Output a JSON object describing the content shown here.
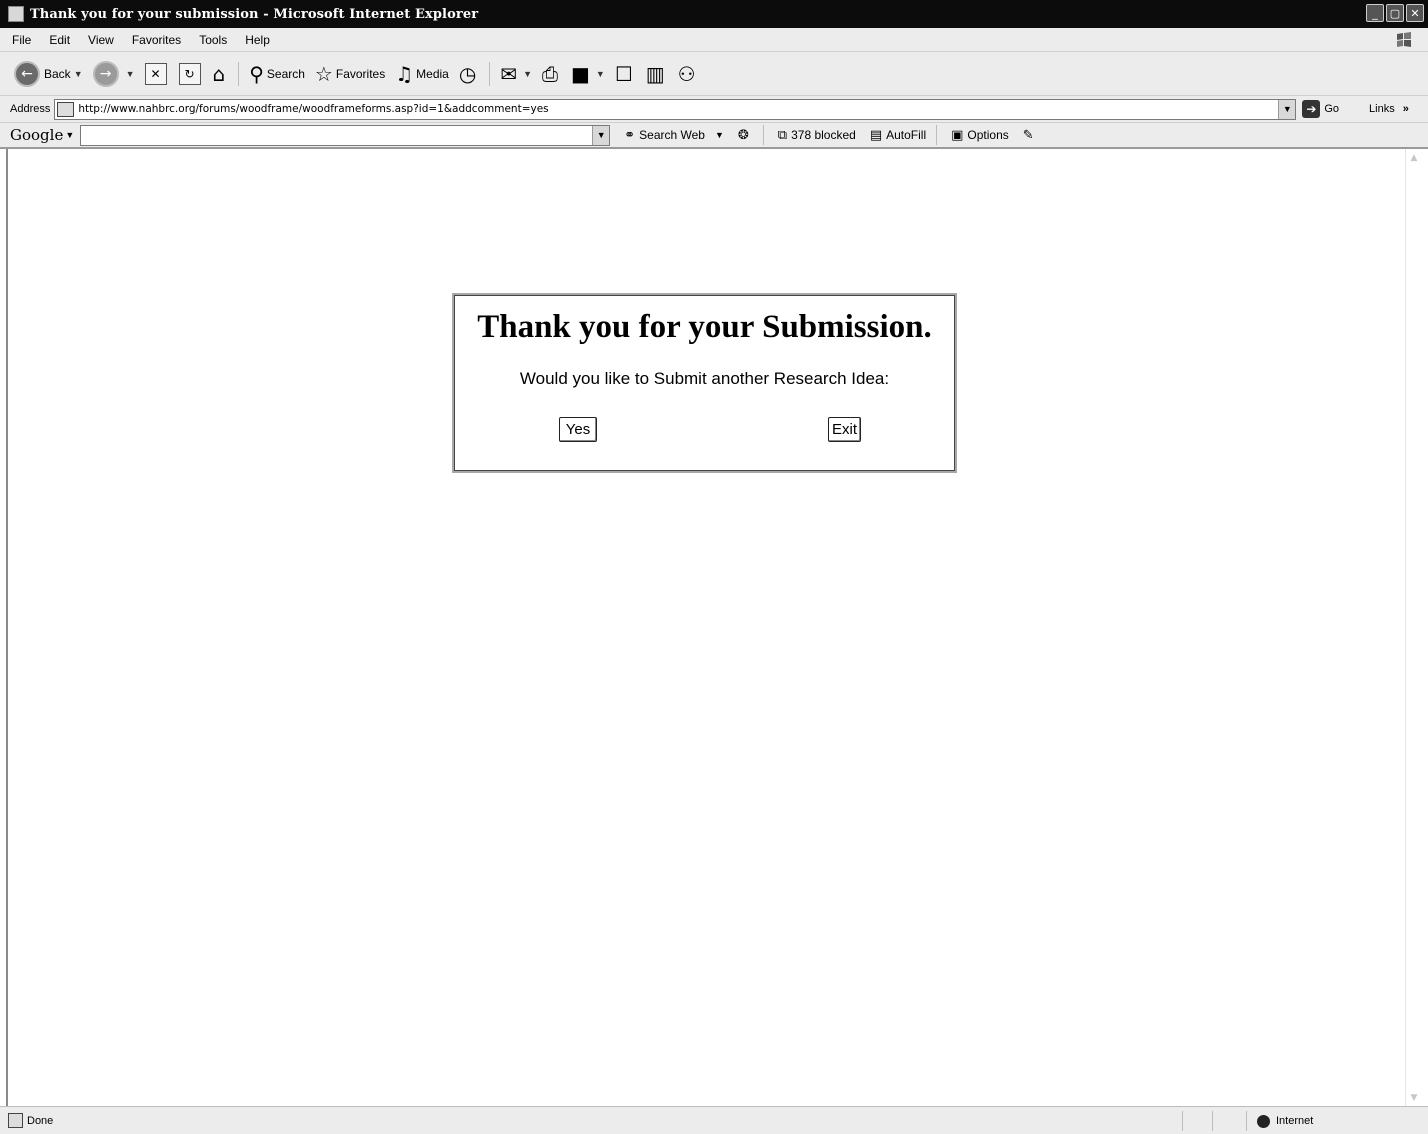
{
  "window": {
    "title": "Thank you for your submission - Microsoft Internet Explorer",
    "controls": [
      "_",
      "▢",
      "✕"
    ]
  },
  "menubar": {
    "items": [
      "File",
      "Edit",
      "View",
      "Favorites",
      "Tools",
      "Help"
    ]
  },
  "toolbar": {
    "back_label": "Back",
    "search_label": "Search",
    "favorites_label": "Favorites",
    "media_label": "Media"
  },
  "addressbar": {
    "label": "Address",
    "url": "http://www.nahbrc.org/forums/woodframe/woodframeforms.asp?id=1&addcomment=yes",
    "go_label": "Go",
    "links_label": "Links"
  },
  "googlebar": {
    "logo": "Google",
    "search_value": "",
    "search_web_label": "Search Web",
    "blocked_label": "378 blocked",
    "autofill_label": "AutoFill",
    "options_label": "Options"
  },
  "dialog": {
    "heading": "Thank you for your Submission.",
    "question": "Would you like to Submit another Research Idea:",
    "yes_label": "Yes",
    "exit_label": "Exit"
  },
  "statusbar": {
    "status_text": "Done",
    "zone_label": "Internet"
  }
}
